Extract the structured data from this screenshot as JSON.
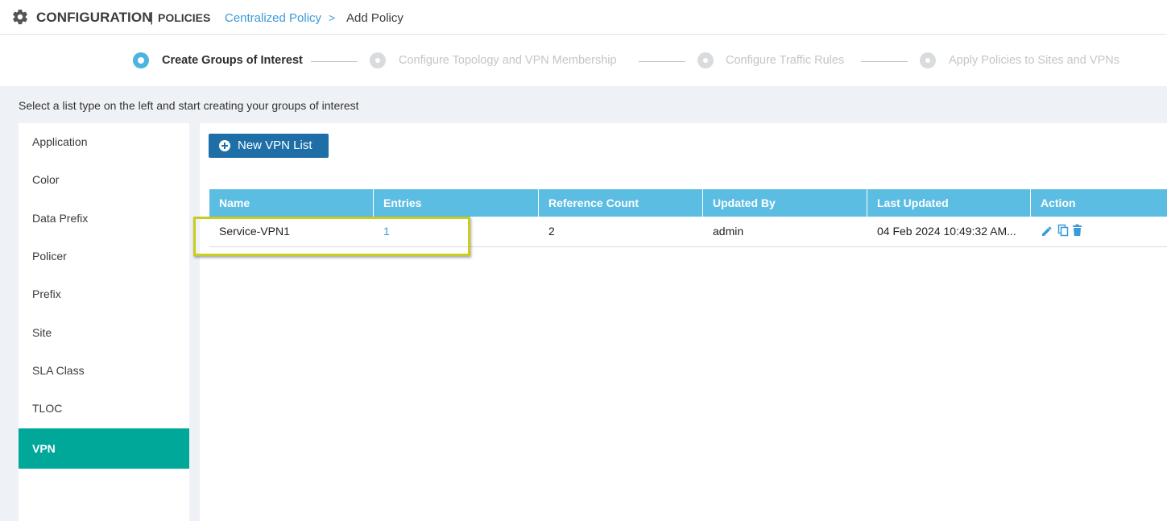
{
  "header": {
    "title": "CONFIGURATION",
    "separator": "|",
    "subtitle": "POLICIES",
    "breadcrumb_link": "Centralized Policy",
    "breadcrumb_arrow": ">",
    "breadcrumb_current": "Add Policy",
    "icon": "gear-icon"
  },
  "wizard": {
    "steps": [
      {
        "label": "Create Groups of Interest",
        "state": "active"
      },
      {
        "label": "Configure Topology and VPN Membership",
        "state": "inactive"
      },
      {
        "label": "Configure Traffic Rules",
        "state": "inactive"
      },
      {
        "label": "Apply Policies to Sites and VPNs",
        "state": "inactive"
      }
    ]
  },
  "instruction": "Select a list type on the left and start creating your groups of interest",
  "sidebar": {
    "items": [
      {
        "label": "Application"
      },
      {
        "label": "Color"
      },
      {
        "label": "Data Prefix"
      },
      {
        "label": "Policer"
      },
      {
        "label": "Prefix"
      },
      {
        "label": "Site"
      },
      {
        "label": "SLA Class"
      },
      {
        "label": "TLOC"
      },
      {
        "label": "VPN",
        "active": true
      }
    ]
  },
  "main": {
    "new_button": "New VPN List",
    "table": {
      "columns": [
        "Name",
        "Entries",
        "Reference Count",
        "Updated By",
        "Last Updated",
        "Action"
      ],
      "rows": [
        {
          "name": "Service-VPN1",
          "entries": "1",
          "reference_count": "2",
          "updated_by": "admin",
          "last_updated": "04 Feb 2024 10:49:32 AM..."
        }
      ],
      "action_icons": [
        "edit-icon",
        "copy-icon",
        "delete-icon"
      ]
    }
  },
  "colors": {
    "accent": "#00a89a",
    "table_header": "#5cbde3",
    "button": "#1e6fa8",
    "link": "#3b9ad8",
    "highlight": "#c8cd1e"
  }
}
